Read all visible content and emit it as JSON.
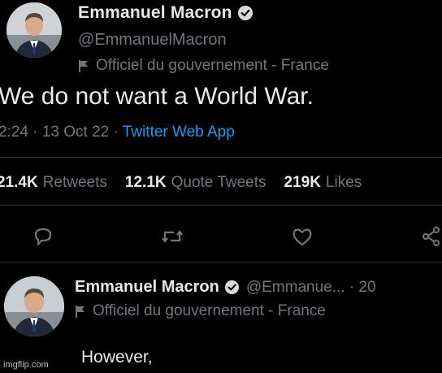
{
  "tweet": {
    "author_name": "Emmanuel Macron",
    "handle": "@EmmanuelMacron",
    "label": "Officiel du gouvernement - France",
    "text": "We do not want a World War.",
    "time": "2:24 · 13 Oct 22 · ",
    "app": "Twitter Web App",
    "stats": {
      "retweets_num": "21.4K",
      "retweets_label": "Retweets",
      "quotes_num": "12.1K",
      "quotes_label": "Quote Tweets",
      "likes_num": "219K",
      "likes_label": "Likes"
    },
    "actions": [
      "reply-icon",
      "retweet-icon",
      "like-icon",
      "share-icon"
    ]
  },
  "reply": {
    "author_name": "Emmanuel Macron",
    "handle": "@Emmanue... · 20",
    "label": "Officiel du gouvernement - France",
    "text": "However,"
  },
  "watermark": "imgflip.com",
  "colors": {
    "background": "#000000",
    "text": "#e7e9ea",
    "secondary": "#71767b",
    "link": "#1d9bf0",
    "verified": "#1d9bf0"
  }
}
